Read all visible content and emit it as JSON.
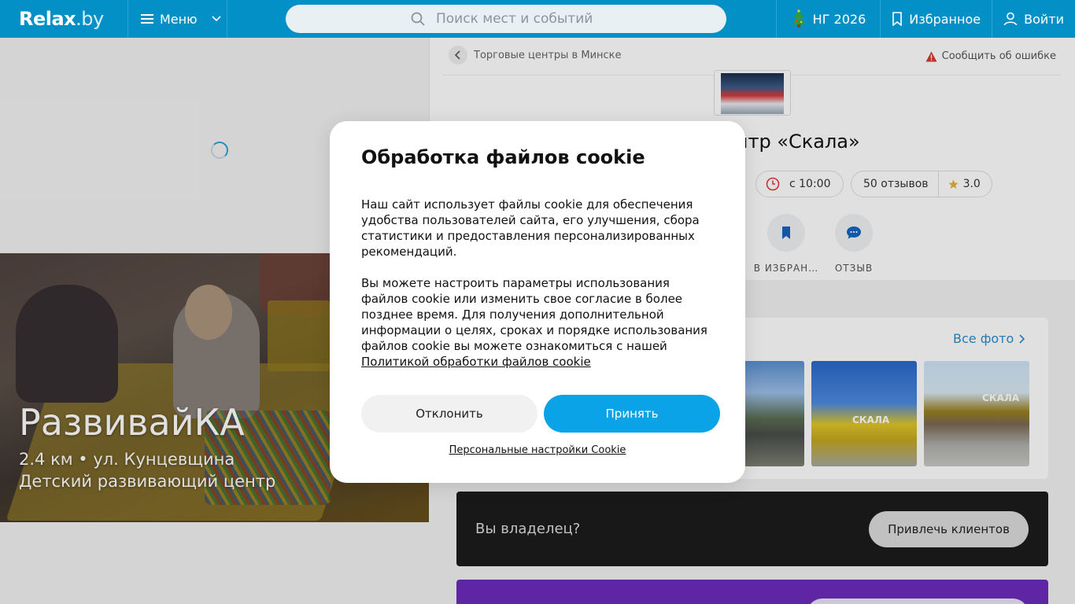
{
  "header": {
    "logo": "Relax",
    "logo_suffix": ".by",
    "menu_label": "Меню",
    "search_placeholder": "Поиск мест и событий",
    "ng_label": "НГ 2026",
    "favorites_label": "Избранное",
    "login_label": "Войти",
    "accent_color": "#0290c7"
  },
  "promo": {
    "title": "РазвивайКА",
    "subtitle": "2.4 км • ул. Кунцевщина",
    "category": "Детский развивающий центр"
  },
  "place": {
    "breadcrumb": "Торговые центры в Минске",
    "report_label": "Сообщить об ошибке",
    "title_visible": "ентр «Скала»",
    "open_time": "с 10:00",
    "reviews_count": "50 отзывов",
    "rating": "3.0",
    "actions": {
      "favorite": "В ИЗБРАН…",
      "review": "ОТЗЫВ"
    },
    "all_photos": "Все фото",
    "photo_label": "СКАЛА"
  },
  "owner_block": {
    "text": "Вы владелец?",
    "button": "Привлечь клиентов"
  },
  "cookie_modal": {
    "title": "Обработка файлов cookie",
    "paragraph1": "Наш сайт использует файлы cookie для обеспечения удобства пользователей сайта, его улучшения, сбора статистики и предоставления персонализированных рекомендаций.",
    "paragraph2": "Вы можете настроить параметры использования файлов cookie или изменить свое согласие в более позднее время. Для получения дополнительной информации о целях, сроках и порядке использования файлов cookie вы можете ознакомиться с нашей",
    "policy_link": "Политикой обработки файлов cookie",
    "decline": "Отклонить",
    "accept": "Принять",
    "personal_settings": "Персональные настройки Cookie",
    "accept_color": "#0aa3e8"
  }
}
